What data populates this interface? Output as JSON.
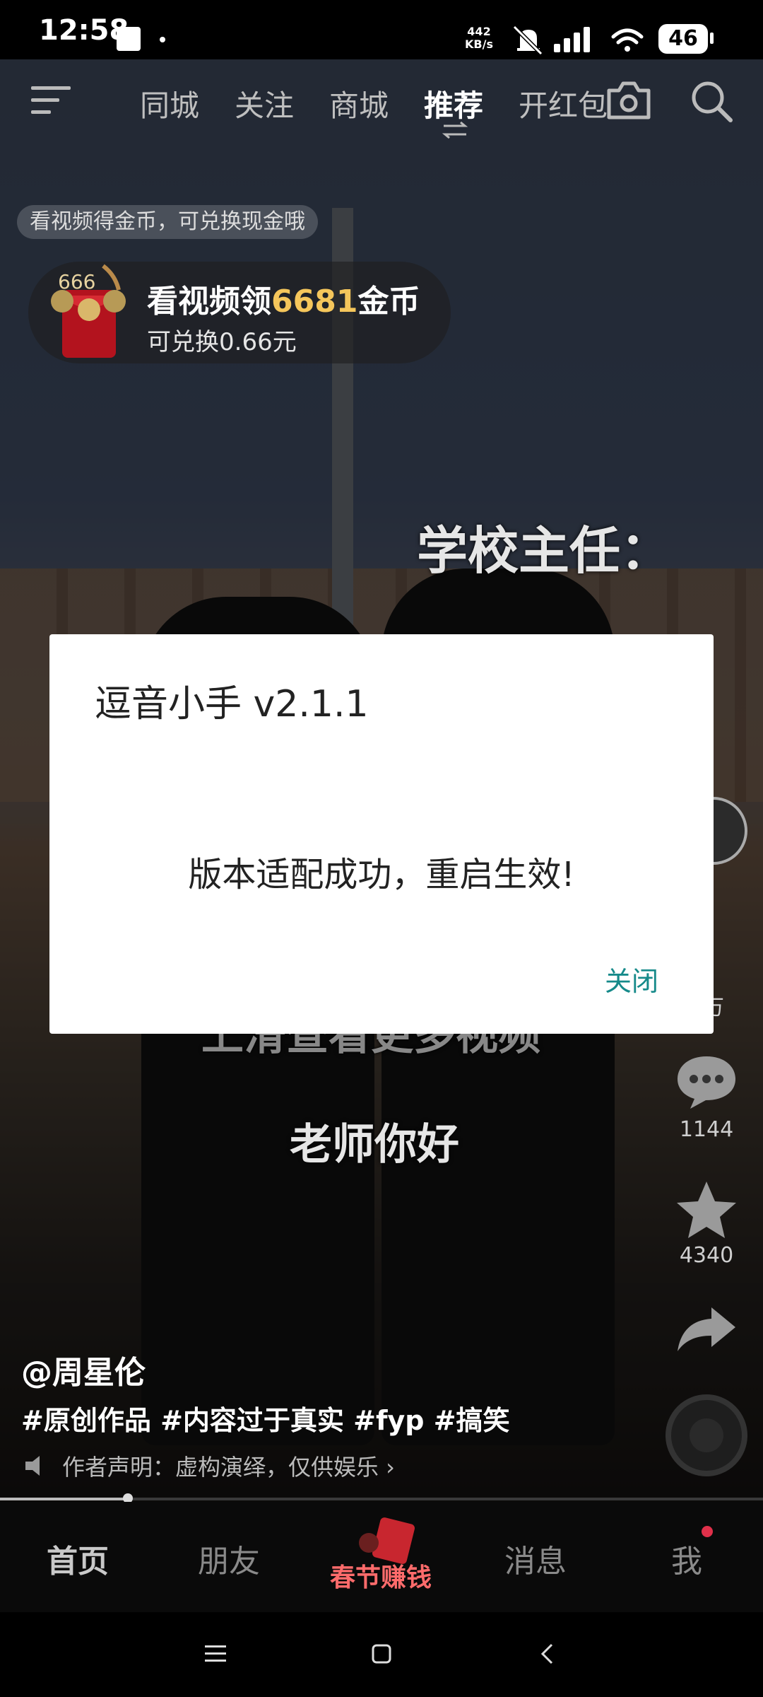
{
  "status_bar": {
    "time": "12:58",
    "net_speed_value": "442",
    "net_speed_unit": "KB/s",
    "battery": "46"
  },
  "top_nav": {
    "tabs": [
      "同城",
      "关注",
      "商城",
      "推荐",
      "开红包"
    ],
    "active_tab": "推荐"
  },
  "coin_promo": {
    "hint": "看视频得金币，可兑换现金哦",
    "title_prefix": "看视频领",
    "amount": "6681",
    "title_suffix": "金币",
    "sub": "可兑换0.66元",
    "badge": "666"
  },
  "video": {
    "caption_top": "学校主任：",
    "caption_hidden": "上滑查看更多视频",
    "caption_bottom": "老师你好",
    "progress_fraction": 0.168
  },
  "right_rail": {
    "likes": "万",
    "comments": "1144",
    "favorites": "4340"
  },
  "post": {
    "author": "@周星伦",
    "tags": "#原创作品 #内容过于真实 #fyp #搞笑",
    "disclaimer": "作者声明：虚构演绎，仅供娱乐 ›"
  },
  "bottom_tabs": {
    "home": "首页",
    "friends": "朋友",
    "spring": "春节赚钱",
    "messages": "消息",
    "me": "我"
  },
  "dialog": {
    "title": "逗音小手 v2.1.1",
    "message": "版本适配成功，重启生效!",
    "close_label": "关闭"
  },
  "colors": {
    "accent_teal": "#168a8a",
    "coin_gold": "#f5c65b",
    "notification_red": "#e0304a"
  },
  "icons": [
    "menu-icon",
    "camera-icon",
    "search-icon",
    "swap-icon",
    "comment-icon",
    "star-icon",
    "share-icon",
    "music-disc-icon",
    "speaker-icon"
  ]
}
